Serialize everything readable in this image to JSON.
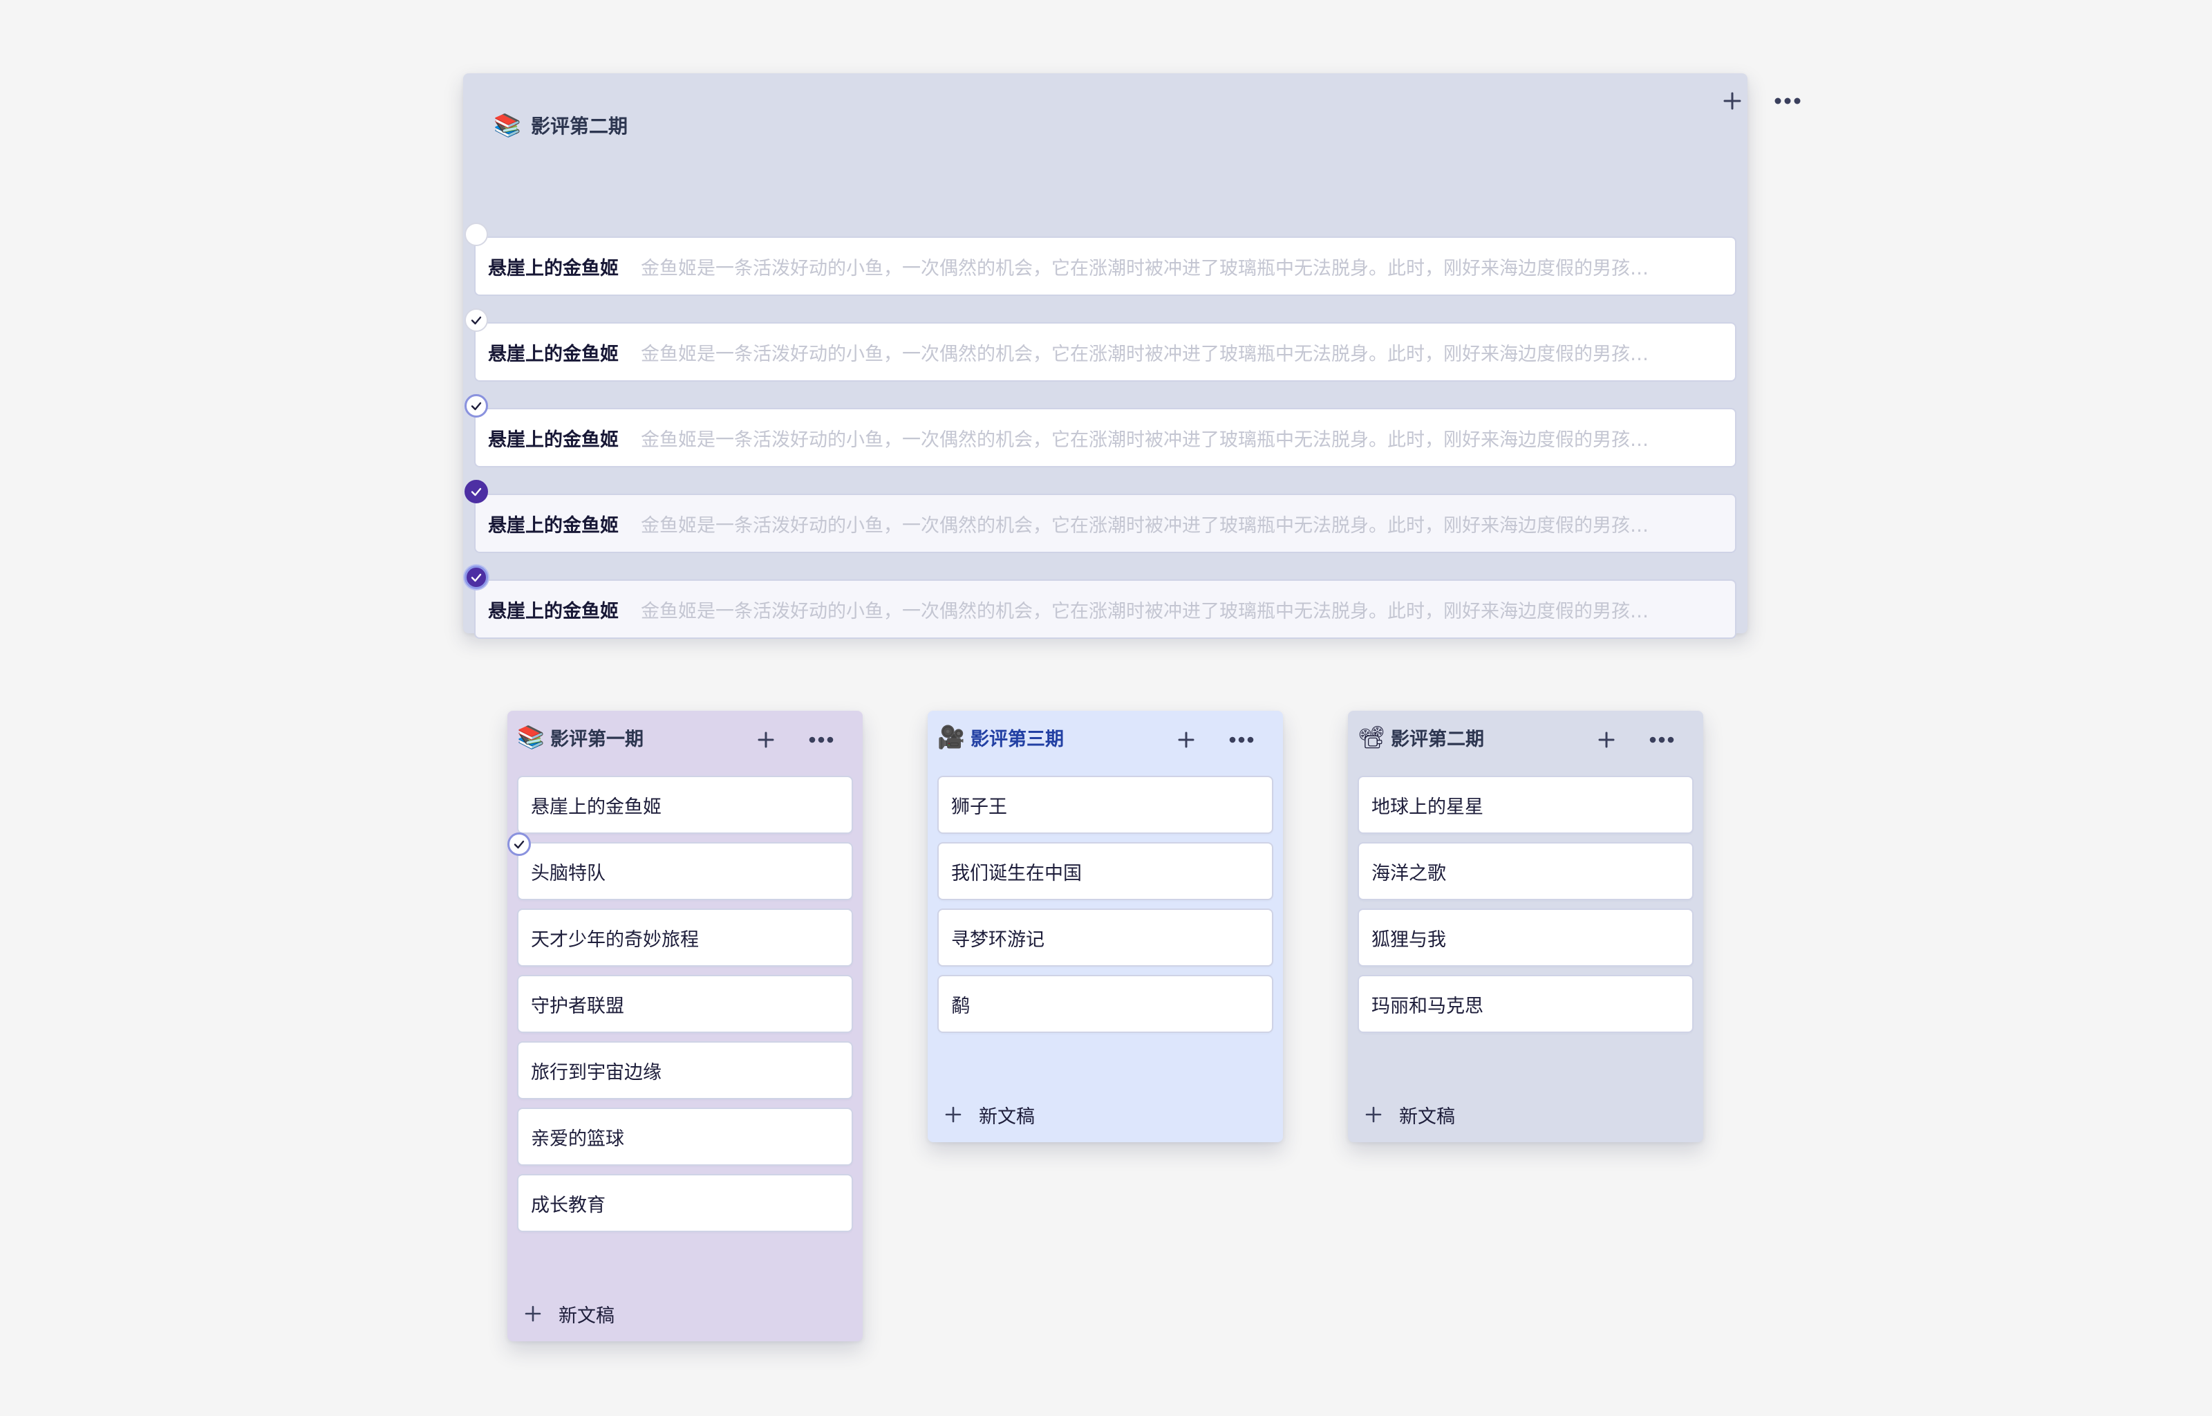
{
  "top_panel": {
    "icon": "books-icon",
    "icon_glyph": "📚",
    "title": "影评第二期",
    "rows": [
      {
        "title": "悬崖上的金鱼姬",
        "desc": "金鱼姬是一条活泼好动的小鱼，一次偶然的机会，它在涨潮时被冲进了玻璃瓶中无法脱身。此时，刚好来海边度假的男孩…",
        "check_state": "empty"
      },
      {
        "title": "悬崖上的金鱼姬",
        "desc": "金鱼姬是一条活泼好动的小鱼，一次偶然的机会，它在涨潮时被冲进了玻璃瓶中无法脱身。此时，刚好来海边度假的男孩…",
        "check_state": "plain"
      },
      {
        "title": "悬崖上的金鱼姬",
        "desc": "金鱼姬是一条活泼好动的小鱼，一次偶然的机会，它在涨潮时被冲进了玻璃瓶中无法脱身。此时，刚好来海边度假的男孩…",
        "check_state": "ring"
      },
      {
        "title": "悬崖上的金鱼姬",
        "desc": "金鱼姬是一条活泼好动的小鱼，一次偶然的机会，它在涨潮时被冲进了玻璃瓶中无法脱身。此时，刚好来海边度假的男孩…",
        "check_state": "fill"
      },
      {
        "title": "悬崖上的金鱼姬",
        "desc": "金鱼姬是一条活泼好动的小鱼，一次偶然的机会，它在涨潮时被冲进了玻璃瓶中无法脱身。此时，刚好来海边度假的男孩…",
        "check_state": "fillring"
      }
    ]
  },
  "columns": [
    {
      "icon": "books-icon",
      "icon_glyph": "📚",
      "title": "影评第一期",
      "background": "#dcd5ec",
      "cards": [
        "悬崖上的金鱼姬",
        "头脑特队",
        "天才少年的奇妙旅程",
        "守护者联盟",
        "旅行到宇宙边缘",
        "亲爱的篮球",
        "成长教育"
      ],
      "new_label": "新文稿"
    },
    {
      "icon": "movie-camera-icon",
      "icon_glyph": "🎥",
      "title": "影评第三期",
      "background": "#dde6fc",
      "cards": [
        "狮子王",
        "我们诞生在中国",
        "寻梦环游记",
        "鹬"
      ],
      "new_label": "新文稿"
    },
    {
      "icon": "film-projector-icon",
      "icon_glyph": "📽",
      "title": "影评第二期",
      "background": "#d8dcea",
      "cards": [
        "地球上的星星",
        "海洋之歌",
        "狐狸与我",
        "玛丽和马克思"
      ],
      "new_label": "新文稿"
    }
  ],
  "colors": {
    "accent": "#4d2fa3",
    "ring": "#8a92de",
    "page_bg": "#f5f5f5"
  }
}
